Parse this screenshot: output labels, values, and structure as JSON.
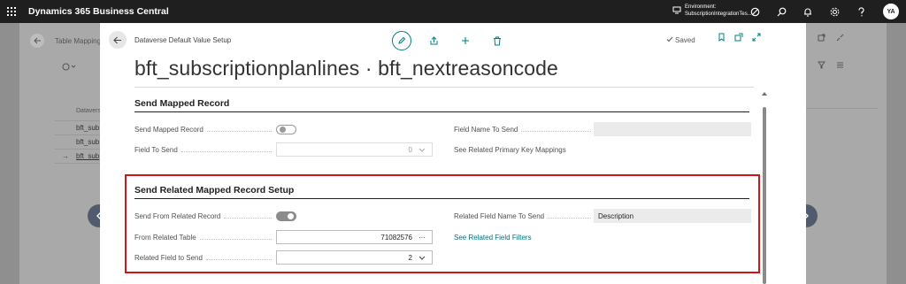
{
  "app": {
    "title": "Dynamics 365 Business Central"
  },
  "environment": {
    "label": "Environment:",
    "name": "SubscriptionIntegrationTes..."
  },
  "topbar_icons": [
    "waffle-icon",
    "environment-icon",
    "copilot-icon",
    "search-icon",
    "bell-icon",
    "gear-icon",
    "help-icon"
  ],
  "user": {
    "initials": "YA"
  },
  "background_page": {
    "title": "Table Mapping",
    "column_header": "Dataverse",
    "rows": [
      "bft_sub",
      "bft_sub",
      "bft_sub"
    ]
  },
  "dialog": {
    "caption": "Dataverse Default Value Setup",
    "title": "bft_subscriptionplanlines · bft_nextreasoncode",
    "saved_label": "Saved",
    "sections": {
      "send_mapped": {
        "title": "Send Mapped Record",
        "send_mapped_record_label": "Send Mapped Record",
        "send_mapped_record_value": false,
        "field_to_send_label": "Field To Send",
        "field_to_send_value": "0",
        "field_name_to_send_label": "Field Name To Send",
        "field_name_to_send_value": "",
        "see_related_pk_label": "See Related Primary Key Mappings"
      },
      "send_related": {
        "title": "Send Related Mapped Record Setup",
        "send_from_related_label": "Send From Related Record",
        "send_from_related_value": true,
        "from_related_table_label": "From Related Table",
        "from_related_table_value": "71082576",
        "related_field_to_send_label": "Related Field to Send",
        "related_field_to_send_value": "2",
        "related_field_name_label": "Related Field Name To Send",
        "related_field_name_value": "Description",
        "see_related_filters_label": "See Related Field Filters"
      }
    }
  },
  "colors": {
    "accent": "#00807f",
    "highlight": "#d1141a",
    "topbar": "#1f1f1f",
    "nav_button": "#505c6e"
  }
}
